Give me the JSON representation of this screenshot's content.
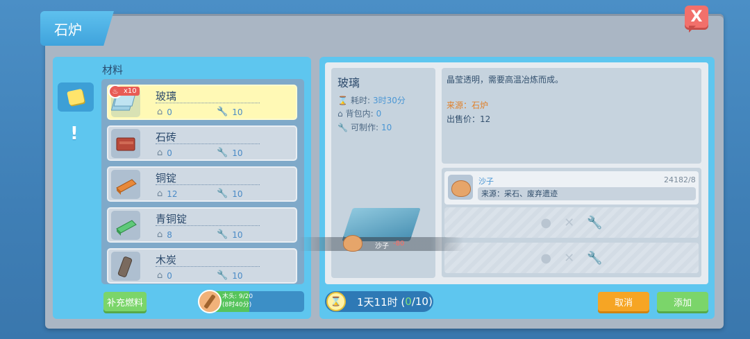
{
  "window": {
    "title": "石炉",
    "close_label": "X"
  },
  "left": {
    "section_label": "材料",
    "tabs": [
      {
        "icon": "note-icon"
      },
      {
        "icon": "exclamation-icon",
        "label": "!"
      }
    ],
    "items": [
      {
        "name": "玻璃",
        "bag": "0",
        "craftable": "10",
        "selected": true,
        "badge": "x10",
        "icon": "glass-icon"
      },
      {
        "name": "石砖",
        "bag": "0",
        "craftable": "10",
        "selected": false,
        "icon": "brick-icon"
      },
      {
        "name": "铜锭",
        "bag": "12",
        "craftable": "10",
        "selected": false,
        "icon": "copper-ingot-icon"
      },
      {
        "name": "青铜锭",
        "bag": "8",
        "craftable": "10",
        "selected": false,
        "icon": "bronze-ingot-icon"
      },
      {
        "name": "木炭",
        "bag": "0",
        "craftable": "10",
        "selected": false,
        "icon": "charcoal-icon"
      }
    ],
    "refuel_label": "补充燃料",
    "fuel": {
      "text_line1": "木头: 9/20",
      "text_line2": "(8时40分)",
      "current": 9,
      "max": 20
    }
  },
  "detail": {
    "name": "玻璃",
    "time_label": "耗时:",
    "time_value": "3时30分",
    "bag_label": "背包内:",
    "bag_value": "0",
    "craft_label": "可制作:",
    "craft_value": "10",
    "description": "晶莹透明，需要高温冶炼而成。",
    "source": "来源：石炉",
    "price": "出售价：12",
    "materials": [
      {
        "name": "沙子",
        "count": "24182/8",
        "source": "来源：采石、废弃遗迹"
      }
    ],
    "empty_slots": 2
  },
  "consume_strip": {
    "name": "沙子",
    "delta": "-80"
  },
  "footer": {
    "timer_prefix": "1天11时 (",
    "timer_current": "0",
    "timer_suffix": "/10)",
    "cancel_label": "取消",
    "add_label": "添加"
  },
  "colors": {
    "accent": "#5ec6ef",
    "selected": "#fff9b5",
    "cancel": "#f6a524",
    "add": "#7bd56a",
    "close": "#f2706b"
  }
}
